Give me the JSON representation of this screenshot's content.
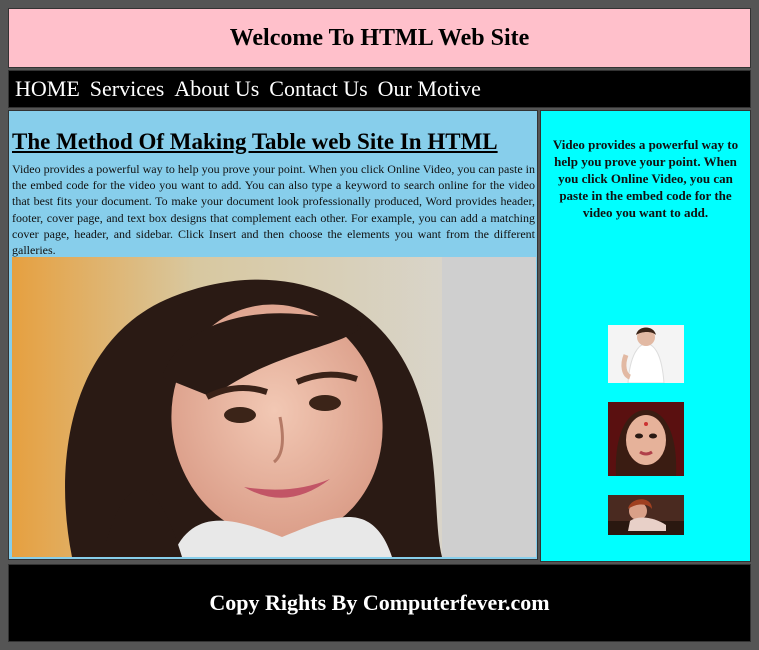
{
  "header": {
    "title": "Welcome To HTML Web Site"
  },
  "nav": {
    "items": [
      "HOME",
      "Services",
      "About Us",
      "Contact Us",
      "Our Motive"
    ]
  },
  "main": {
    "heading": "The Method Of Making Table web Site In HTML",
    "paragraph": "Video provides a powerful way to help you prove your point. When you click Online Video, you can paste in the embed code for the video you want to add. You can also type a keyword to search online for the video that best fits your document. To make your document look professionally produced, Word provides header, footer, cover page, and text box designs that complement each other. For example, you can add a matching cover page, header, and sidebar. Click Insert and then choose the elements you want from the different galleries."
  },
  "sidebar": {
    "text": "Video provides a powerful way to help you prove your point. When you click Online Video, you can paste in the embed code for the video you want to add."
  },
  "footer": {
    "text": "Copy Rights By Computerfever.com"
  },
  "colors": {
    "header_bg": "#ffc0cb",
    "nav_bg": "#000000",
    "main_bg": "#87ceeb",
    "side_bg": "#00ffff",
    "footer_bg": "#000000"
  }
}
